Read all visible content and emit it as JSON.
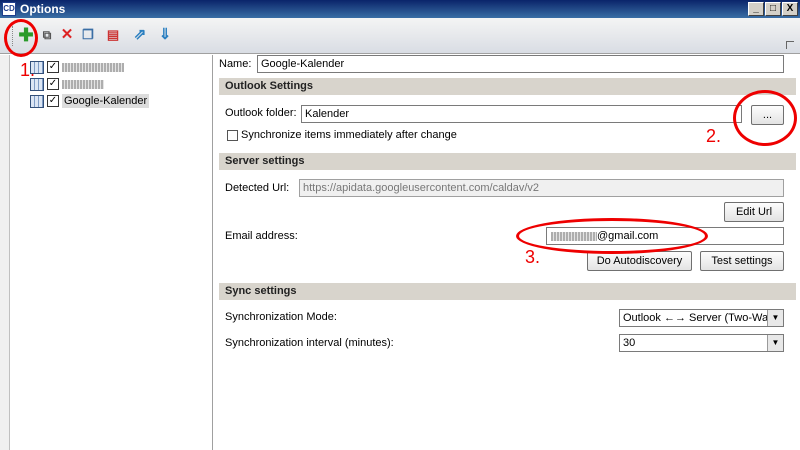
{
  "window": {
    "icon_text": "CD",
    "title": "Options",
    "minimize": "_",
    "maximize": "□",
    "close": "X"
  },
  "toolbar": {
    "icons": [
      "add-icon",
      "copy-settings-icon",
      "delete-icon",
      "duplicate-icon",
      "delete-multiple-icon",
      "export-icon",
      "import-icon"
    ]
  },
  "tree": {
    "items": [
      {
        "label": "",
        "checked": "✓"
      },
      {
        "label": "",
        "checked": "✓"
      },
      {
        "label": "Google-Kalender",
        "checked": "✓"
      }
    ]
  },
  "form": {
    "name_label": "Name:",
    "name_value": "Google-Kalender",
    "outlook_section": "Outlook Settings",
    "outlook_folder_label": "Outlook folder:",
    "outlook_folder_value": "Kalender",
    "browse_button": "...",
    "sync_immediately_label": "Synchronize items immediately after change",
    "server_section": "Server settings",
    "detected_url_label": "Detected Url:",
    "detected_url_value": "https://apidata.googleusercontent.com/caldav/v2",
    "edit_url_button": "Edit Url",
    "email_label": "Email address:",
    "email_value": "@gmail.com",
    "autodiscovery_button": "Do Autodiscovery",
    "test_button": "Test settings",
    "sync_section": "Sync settings",
    "sync_mode_label": "Synchronization Mode:",
    "sync_mode_value": "Outlook ←→ Server (Two-Way)",
    "sync_interval_label": "Synchronization interval (minutes):",
    "sync_interval_value": "30"
  },
  "annotations": {
    "one": "1.",
    "two": "2.",
    "three": "3."
  }
}
